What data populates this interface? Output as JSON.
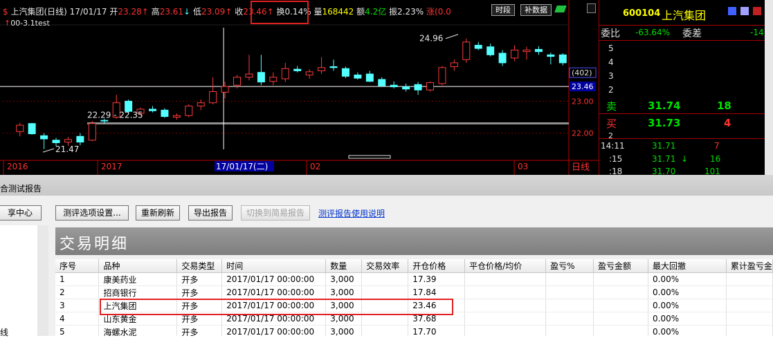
{
  "chart": {
    "stock_name": "上汽集团(日线)",
    "date": "17/01/17",
    "open_label": "开",
    "open": "23.28",
    "high_label": "高",
    "high": "23.61",
    "low_label": "低",
    "low": "23.09",
    "close_label": "收",
    "close": "23.46",
    "change_label": "换",
    "change": "0.14%",
    "volume_label": "量",
    "volume": "168442",
    "amount_label": "额",
    "amount": "4.2亿",
    "amplitude_label": "振",
    "amplitude": "2.23%",
    "rise_label": "涨",
    "rise": "(0.0",
    "period_button": "时段",
    "supplement_button": "补数据",
    "indicator": "00-3.1test",
    "price_levels": [
      "23.46",
      "23.00",
      "22.00"
    ],
    "count_badge": "(402)",
    "annotations": {
      "peak": "24.96",
      "range": "22.29 - 22.35",
      "low": "21.47"
    },
    "x_labels": [
      "2016",
      "2017",
      "17/01/17(二)",
      "02",
      "03"
    ],
    "period_tag": "日线",
    "candles": [
      {
        "o": 22.05,
        "h": 22.32,
        "l": 21.9,
        "c": 22.25
      },
      {
        "o": 22.3,
        "h": 22.32,
        "l": 21.95,
        "c": 21.98
      },
      {
        "o": 21.92,
        "h": 22.0,
        "l": 21.5,
        "c": 21.82
      },
      {
        "o": 21.78,
        "h": 21.85,
        "l": 21.6,
        "c": 21.7
      },
      {
        "o": 21.72,
        "h": 21.88,
        "l": 21.6,
        "c": 21.8
      },
      {
        "o": 21.9,
        "h": 22.0,
        "l": 21.62,
        "c": 21.72
      },
      {
        "o": 21.78,
        "h": 22.38,
        "l": 21.75,
        "c": 22.3
      },
      {
        "o": 22.4,
        "h": 22.45,
        "l": 22.3,
        "c": 22.38
      },
      {
        "o": 22.5,
        "h": 23.2,
        "l": 22.45,
        "c": 22.95
      },
      {
        "o": 23.0,
        "h": 23.05,
        "l": 22.6,
        "c": 22.68
      },
      {
        "o": 22.62,
        "h": 22.8,
        "l": 22.55,
        "c": 22.75
      },
      {
        "o": 22.75,
        "h": 22.85,
        "l": 22.65,
        "c": 22.7
      },
      {
        "o": 22.72,
        "h": 22.78,
        "l": 22.48,
        "c": 22.52
      },
      {
        "o": 22.5,
        "h": 22.62,
        "l": 22.42,
        "c": 22.55
      },
      {
        "o": 22.55,
        "h": 22.9,
        "l": 22.5,
        "c": 22.85
      },
      {
        "o": 22.85,
        "h": 23.05,
        "l": 22.72,
        "c": 22.95
      },
      {
        "o": 22.95,
        "h": 23.75,
        "l": 22.9,
        "c": 23.3
      },
      {
        "o": 23.28,
        "h": 23.61,
        "l": 23.09,
        "c": 23.46
      },
      {
        "o": 23.5,
        "h": 23.82,
        "l": 23.4,
        "c": 23.75
      },
      {
        "o": 23.75,
        "h": 24.45,
        "l": 23.65,
        "c": 23.85
      },
      {
        "o": 23.9,
        "h": 24.45,
        "l": 23.5,
        "c": 23.6
      },
      {
        "o": 23.62,
        "h": 23.9,
        "l": 23.5,
        "c": 23.75
      },
      {
        "o": 23.7,
        "h": 24.2,
        "l": 23.6,
        "c": 24.02
      },
      {
        "o": 24.0,
        "h": 24.1,
        "l": 23.9,
        "c": 23.95
      },
      {
        "o": 23.82,
        "h": 24.0,
        "l": 23.7,
        "c": 23.92
      },
      {
        "o": 23.95,
        "h": 24.38,
        "l": 23.85,
        "c": 24.05
      },
      {
        "o": 24.08,
        "h": 24.3,
        "l": 23.95,
        "c": 24.05
      },
      {
        "o": 24.02,
        "h": 24.08,
        "l": 23.72,
        "c": 23.78
      },
      {
        "o": 23.82,
        "h": 23.9,
        "l": 23.68,
        "c": 23.72
      },
      {
        "o": 23.85,
        "h": 23.95,
        "l": 23.6,
        "c": 23.62
      },
      {
        "o": 23.68,
        "h": 23.75,
        "l": 23.45,
        "c": 23.48
      },
      {
        "o": 23.5,
        "h": 23.62,
        "l": 23.4,
        "c": 23.45
      },
      {
        "o": 23.45,
        "h": 23.55,
        "l": 23.3,
        "c": 23.38
      },
      {
        "o": 23.52,
        "h": 23.6,
        "l": 23.2,
        "c": 23.35
      },
      {
        "o": 23.35,
        "h": 23.62,
        "l": 23.3,
        "c": 23.58
      },
      {
        "o": 23.55,
        "h": 24.1,
        "l": 23.5,
        "c": 24.05
      },
      {
        "o": 24.08,
        "h": 24.3,
        "l": 23.95,
        "c": 24.2
      },
      {
        "o": 24.3,
        "h": 24.96,
        "l": 24.2,
        "c": 24.85
      },
      {
        "o": 24.75,
        "h": 24.85,
        "l": 24.6,
        "c": 24.65
      },
      {
        "o": 24.7,
        "h": 24.8,
        "l": 24.4,
        "c": 24.45
      },
      {
        "o": 24.5,
        "h": 24.6,
        "l": 24.1,
        "c": 24.2
      },
      {
        "o": 24.35,
        "h": 24.75,
        "l": 24.25,
        "c": 24.6
      },
      {
        "o": 24.55,
        "h": 24.7,
        "l": 24.3,
        "c": 24.6
      },
      {
        "o": 24.62,
        "h": 24.72,
        "l": 24.45,
        "c": 24.55
      },
      {
        "o": 24.45,
        "h": 24.52,
        "l": 24.15,
        "c": 24.4
      },
      {
        "o": 24.45,
        "h": 24.5,
        "l": 24.12,
        "c": 24.2
      }
    ]
  },
  "quote": {
    "code": "600104",
    "name": "上汽集团",
    "ratio_label": "委比",
    "ratio": "-63.64%",
    "diff_label": "委差",
    "diff": "-14",
    "sell_levels": [
      "5",
      "4",
      "3",
      "2"
    ],
    "sell_label": "卖",
    "sell_price": "31.74",
    "sell_vol": "18",
    "buy_label": "买",
    "buy_price": "31.73",
    "buy_vol": "4",
    "buy_level_2": "2",
    "ticks": [
      {
        "time": "14:11",
        "price": "31.71",
        "arrow": "",
        "vol": "7"
      },
      {
        "time": ":15",
        "price": "31.71",
        "arrow": "↓",
        "vol": "16"
      },
      {
        "time": ":18",
        "price": "31.70",
        "arrow": "",
        "vol": "101"
      }
    ]
  },
  "app": {
    "title": "合测试报告",
    "buttons": {
      "share_center": "享中心",
      "options": "测评选项设置...",
      "refresh": "重新刷新",
      "export": "导出报告",
      "simple": "切换到简易报告"
    },
    "help_link": "测评报告使用说明",
    "section_title": "交易明细",
    "left_label": "线",
    "table": {
      "headers": [
        "序号",
        "品种",
        "交易类型",
        "时间",
        "数量",
        "交易效率",
        "开仓价格",
        "平仓价格/均价",
        "盈亏%",
        "盈亏金额",
        "最大回撤",
        "累计盈亏金"
      ],
      "rows": [
        [
          "1",
          "康美药业",
          "开多",
          "2017/01/17 00:00:00",
          "3,000",
          "",
          "17.39",
          "",
          "",
          "",
          "0.00%",
          ""
        ],
        [
          "2",
          "招商银行",
          "开多",
          "2017/01/17 00:00:00",
          "3,000",
          "",
          "17.84",
          "",
          "",
          "",
          "0.00%",
          ""
        ],
        [
          "3",
          "上汽集团",
          "开多",
          "2017/01/17 00:00:00",
          "3,000",
          "",
          "23.46",
          "",
          "",
          "",
          "0.00%",
          ""
        ],
        [
          "4",
          "山东黄金",
          "开多",
          "2017/01/17 00:00:00",
          "3,000",
          "",
          "37.68",
          "",
          "",
          "",
          "0.00%",
          ""
        ],
        [
          "5",
          "海螺水泥",
          "开多",
          "2017/01/17 00:00:00",
          "3,000",
          "",
          "17.70",
          "",
          "",
          "",
          "0.00%",
          ""
        ]
      ]
    }
  }
}
